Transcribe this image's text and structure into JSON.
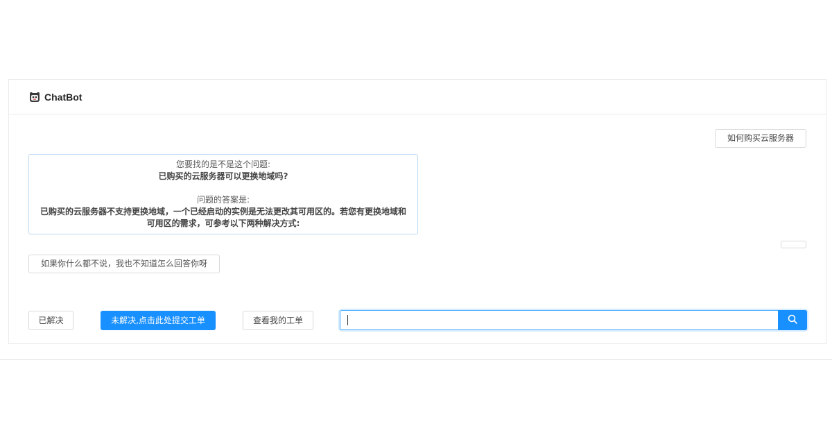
{
  "header": {
    "title": "ChatBot",
    "icon": "bot-avatar-icon"
  },
  "messages": {
    "user_question": "如何购买云服务器",
    "answer": {
      "question_label": "您要找的是不是这个问题:",
      "question_text": "已购买的云服务器可以更换地域吗?",
      "answer_label": "问题的答案是:",
      "answer_text": "已购买的云服务器不支持更换地域，一个已经启动的实例是无法更改其可用区的。若您有更换地域和可用区的需求，可参考以下两种解决方式:"
    },
    "bot_reply": "如果你什么都不说，我也不知道怎么回答你呀"
  },
  "actions": {
    "resolved_label": "已解决",
    "unresolved_label": "未解决,点击此处提交工单",
    "my_tickets_label": "查看我的工单"
  },
  "search": {
    "value": "",
    "placeholder": "",
    "icon": "search-icon"
  },
  "colors": {
    "primary": "#1890ff",
    "answer_border": "#bcd9f0",
    "border": "#d9d9d9"
  }
}
